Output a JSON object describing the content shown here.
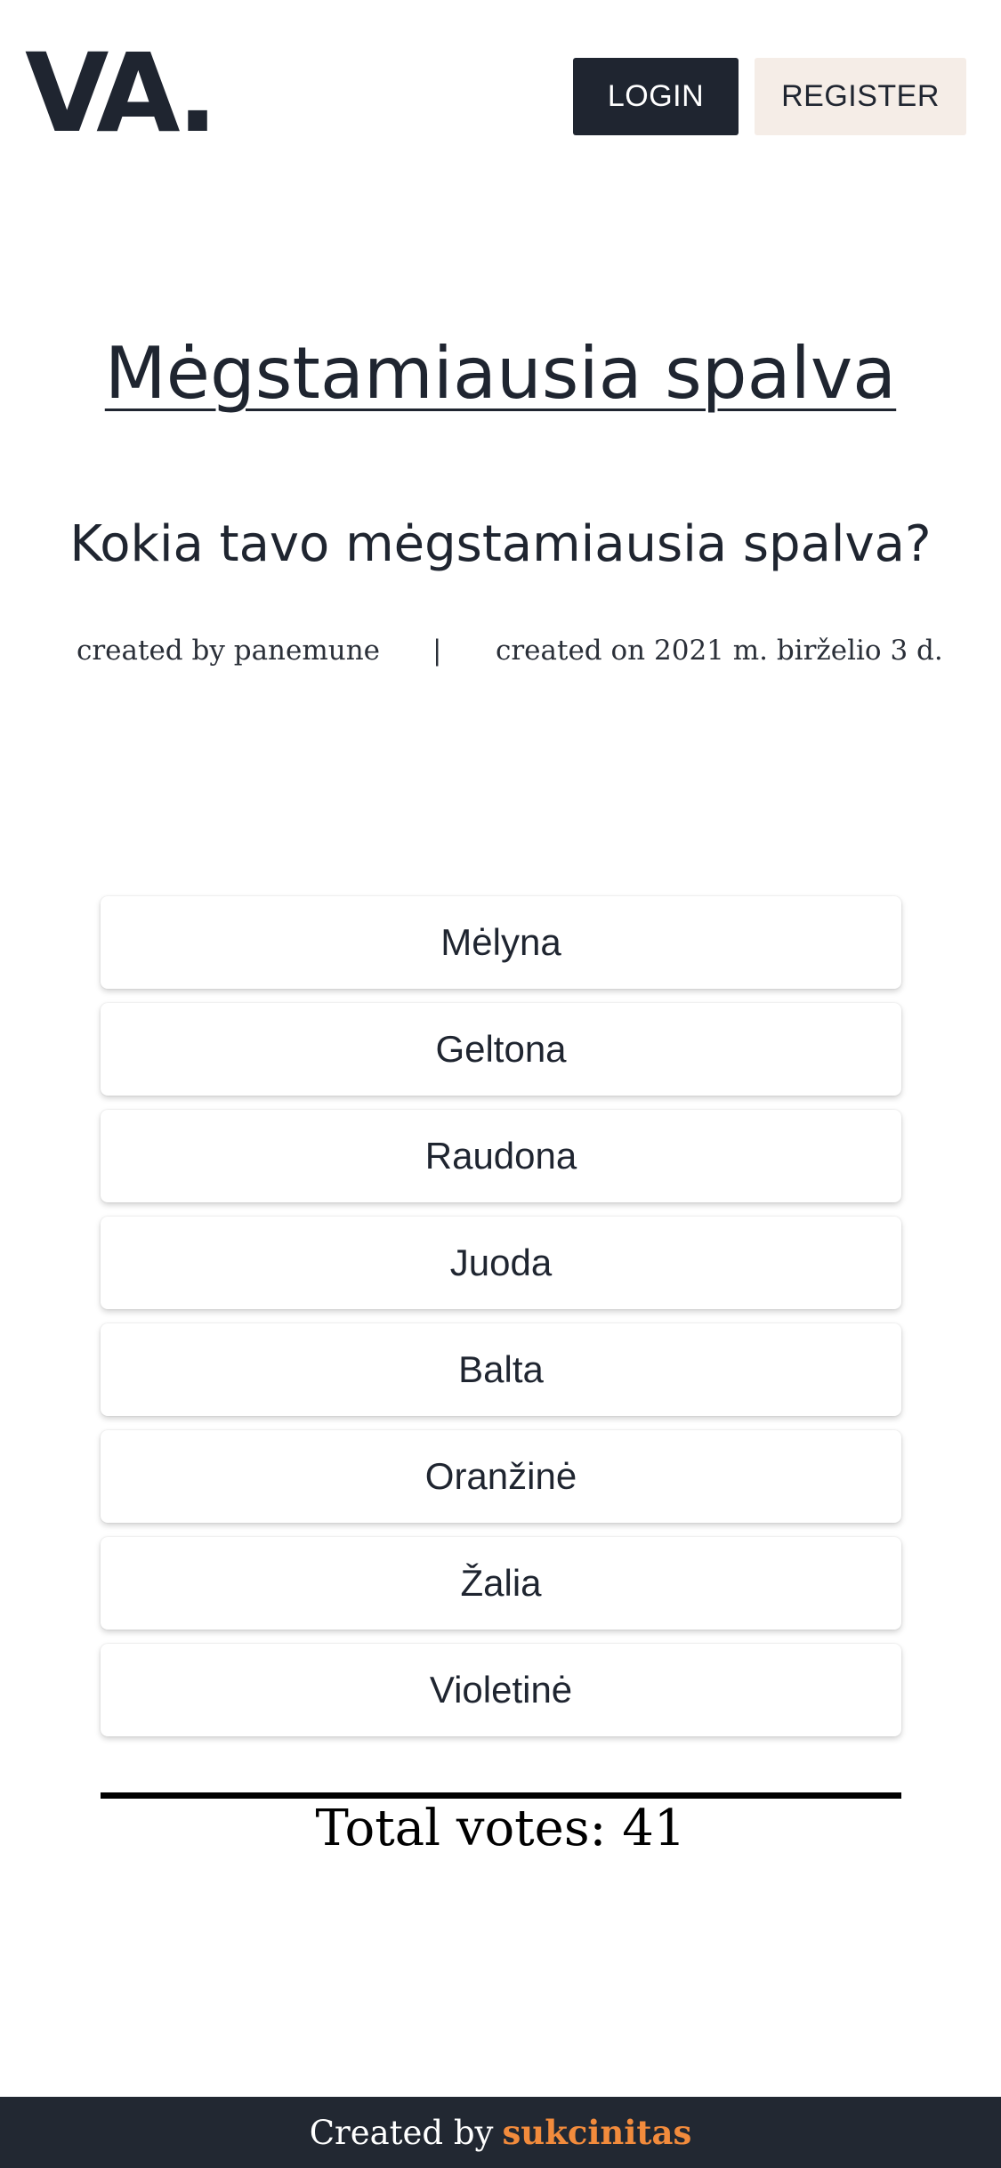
{
  "header": {
    "logo": "VA.",
    "login_label": "LOGIN",
    "register_label": "REGISTER"
  },
  "poll": {
    "title": "Mėgstamiausia spalva",
    "question": "Kokia tavo mėgstamiausia spalva?",
    "created_by": "created by panemune",
    "separator": "|",
    "created_on": "created on 2021 m. birželio 3 d.",
    "options": [
      {
        "label": "Mėlyna"
      },
      {
        "label": "Geltona"
      },
      {
        "label": "Raudona"
      },
      {
        "label": "Juoda"
      },
      {
        "label": "Balta"
      },
      {
        "label": "Oranžinė"
      },
      {
        "label": "Žalia"
      },
      {
        "label": "Violetinė"
      }
    ],
    "total_votes": "Total votes: 41"
  },
  "footer": {
    "prefix": "Created by",
    "author": "sukcinitas"
  },
  "colors": {
    "primary_dark": "#1f2530",
    "register_bg": "#f5ede7",
    "footer_bg": "#222832",
    "accent": "#f28b3c"
  }
}
